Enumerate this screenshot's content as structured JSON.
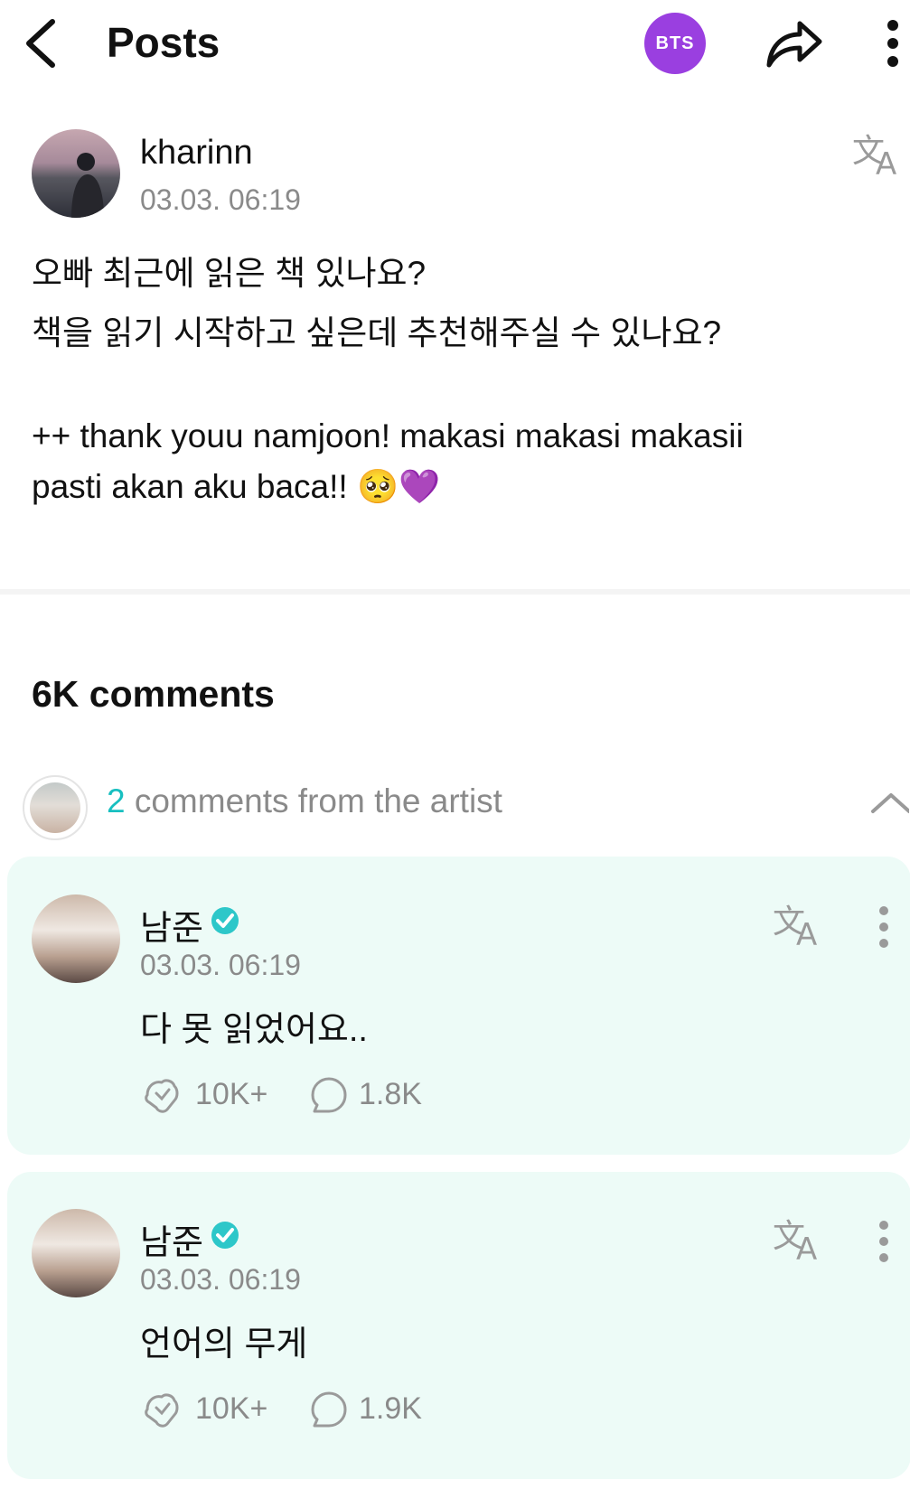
{
  "header": {
    "title": "Posts",
    "community_badge": "BTS",
    "icons": [
      "back-icon",
      "share-icon",
      "more-vertical-icon"
    ]
  },
  "post": {
    "author": "kharinn",
    "timestamp": "03.03. 06:19",
    "lines": [
      "오빠 최근에 읽은 책 있나요?",
      "책을 읽기 시작하고 싶은데 추천해주실 수 있나요?",
      "++ thank youu namjoon! makasi makasi makasii",
      "pasti akan aku baca!! 🥺💜"
    ]
  },
  "comments": {
    "count_label": "6K comments",
    "artist_count": "2",
    "artist_label": " comments from the artist",
    "items": [
      {
        "author": "남준",
        "timestamp": "03.03. 06:19",
        "text": "다 못 읽었어요..",
        "likes": "10K+",
        "replies": "1.8K"
      },
      {
        "author": "남준",
        "timestamp": "03.03. 06:19",
        "text": "언어의 무게",
        "likes": "10K+",
        "replies": "1.9K"
      }
    ]
  },
  "colors": {
    "accent": "#17bfc0",
    "brand": "#9a3fe0",
    "card_bg": "#edfbf7",
    "verified": "#2dc7c9"
  }
}
